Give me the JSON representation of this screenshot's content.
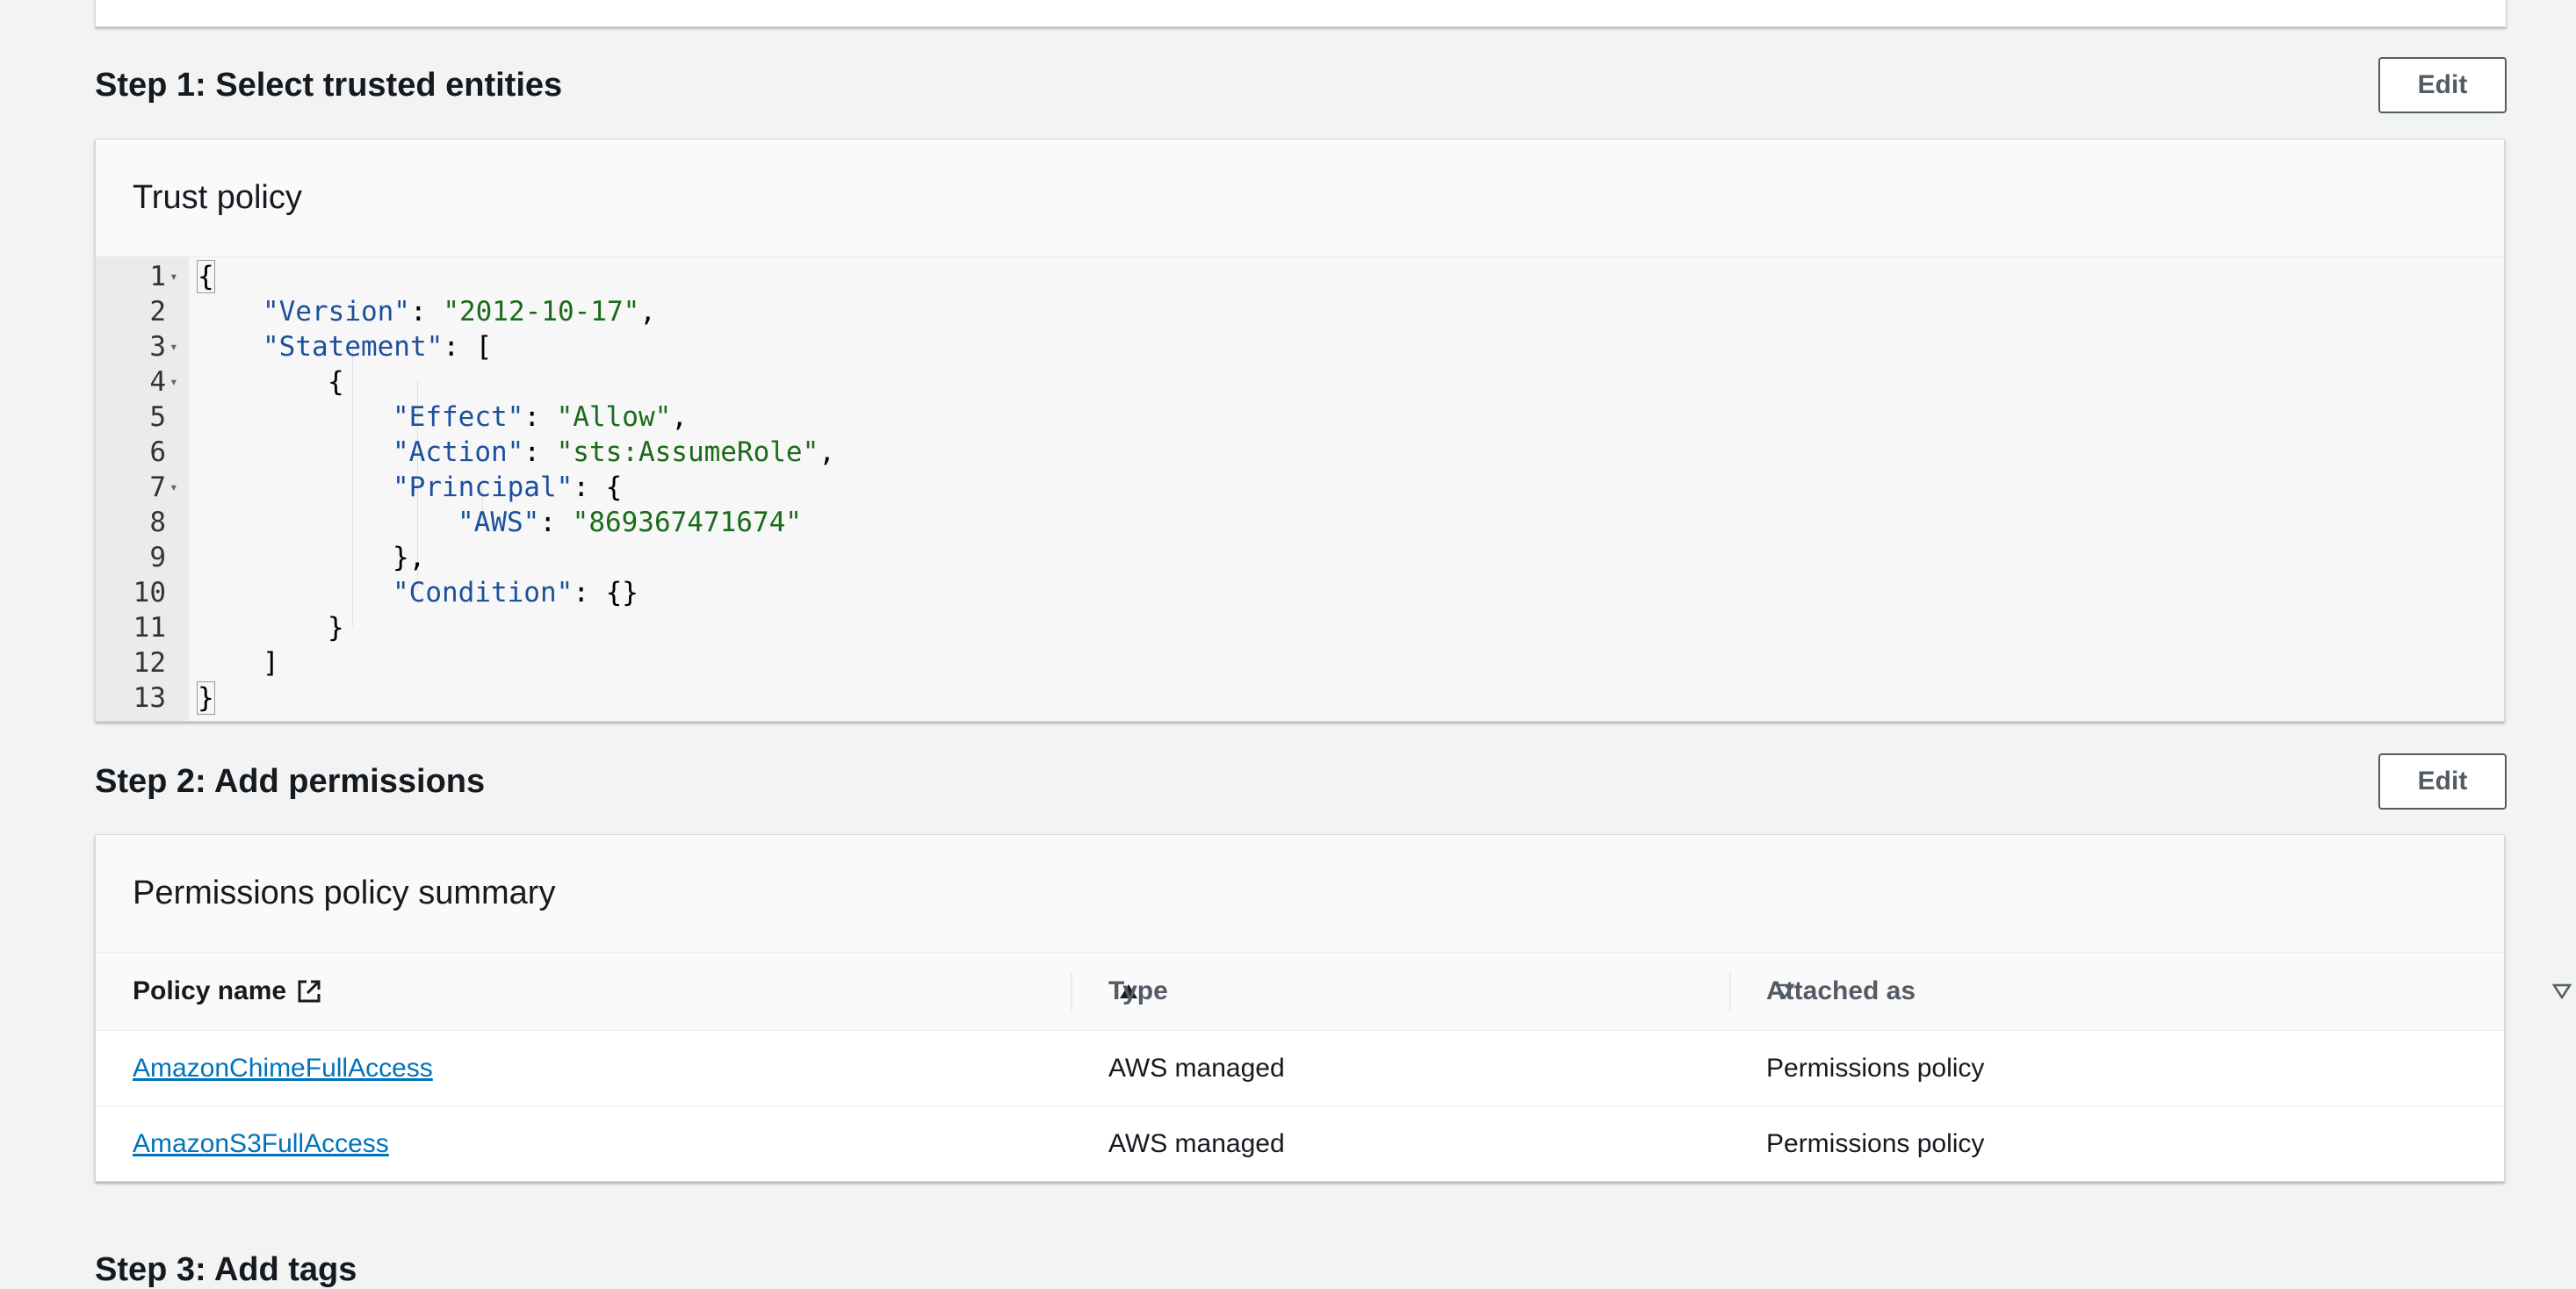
{
  "step1": {
    "title": "Step 1: Select trusted entities",
    "edit_label": "Edit",
    "card_title": "Trust policy",
    "code_lines": [
      {
        "n": "1",
        "fold": true
      },
      {
        "n": "2",
        "fold": false
      },
      {
        "n": "3",
        "fold": true
      },
      {
        "n": "4",
        "fold": true
      },
      {
        "n": "5",
        "fold": false
      },
      {
        "n": "6",
        "fold": false
      },
      {
        "n": "7",
        "fold": true
      },
      {
        "n": "8",
        "fold": false
      },
      {
        "n": "9",
        "fold": false
      },
      {
        "n": "10",
        "fold": false
      },
      {
        "n": "11",
        "fold": false
      },
      {
        "n": "12",
        "fold": false
      },
      {
        "n": "13",
        "fold": false
      }
    ],
    "code": {
      "l1": "{",
      "l2_key": "\"Version\"",
      "l2_sep": ": ",
      "l2_val": "\"2012-10-17\"",
      "l2_end": ",",
      "l3_key": "\"Statement\"",
      "l3_rest": ": [",
      "l4": "{",
      "l5_key": "\"Effect\"",
      "l5_sep": ": ",
      "l5_val": "\"Allow\"",
      "l5_end": ",",
      "l6_key": "\"Action\"",
      "l6_sep": ": ",
      "l6_val": "\"sts:AssumeRole\"",
      "l6_end": ",",
      "l7_key": "\"Principal\"",
      "l7_rest": ": {",
      "l8_key": "\"AWS\"",
      "l8_sep": ": ",
      "l8_val": "\"869367471674\"",
      "l9": "},",
      "l10_key": "\"Condition\"",
      "l10_rest": ": {}",
      "l11": "}",
      "l12": "]",
      "l13": "}"
    }
  },
  "step2": {
    "title": "Step 2: Add permissions",
    "edit_label": "Edit",
    "card_title": "Permissions policy summary",
    "columns": [
      "Policy name",
      "Type",
      "Attached as"
    ],
    "rows": [
      {
        "name": "AmazonChimeFullAccess",
        "type": "AWS managed",
        "attached": "Permissions policy"
      },
      {
        "name": "AmazonS3FullAccess",
        "type": "AWS managed",
        "attached": "Permissions policy"
      }
    ]
  },
  "step3": {
    "title": "Step 3: Add tags"
  }
}
